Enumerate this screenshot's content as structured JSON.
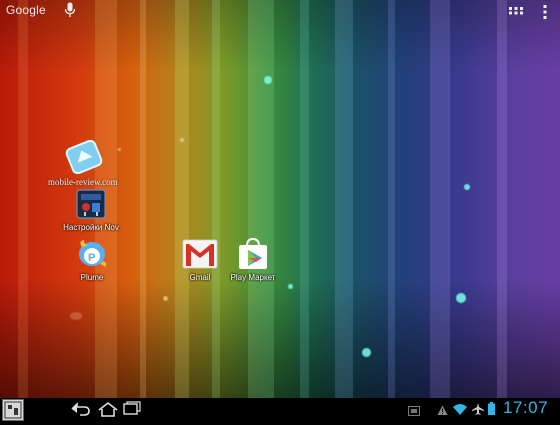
{
  "top_bar": {
    "search_label": "Google"
  },
  "watermark": "mobile-review.com",
  "desktop": {
    "shortcuts": [
      {
        "label": "Настройки Nov",
        "icon": "nova-settings-icon"
      },
      {
        "label": "Plume",
        "icon": "plume-bird-icon"
      },
      {
        "label": "Gmail",
        "icon": "gmail-envelope-icon"
      },
      {
        "label": "Play Маркет",
        "icon": "play-store-bag-icon"
      }
    ],
    "unlabeled_icon": "mobile-review-logo-icon"
  },
  "system_bar": {
    "time": "17:07",
    "nav": [
      "back-icon",
      "home-icon",
      "recent-apps-icon"
    ]
  },
  "colors": {
    "accent": "#33b5e5",
    "gmail_red": "#d93025",
    "label": "#ffffff"
  }
}
